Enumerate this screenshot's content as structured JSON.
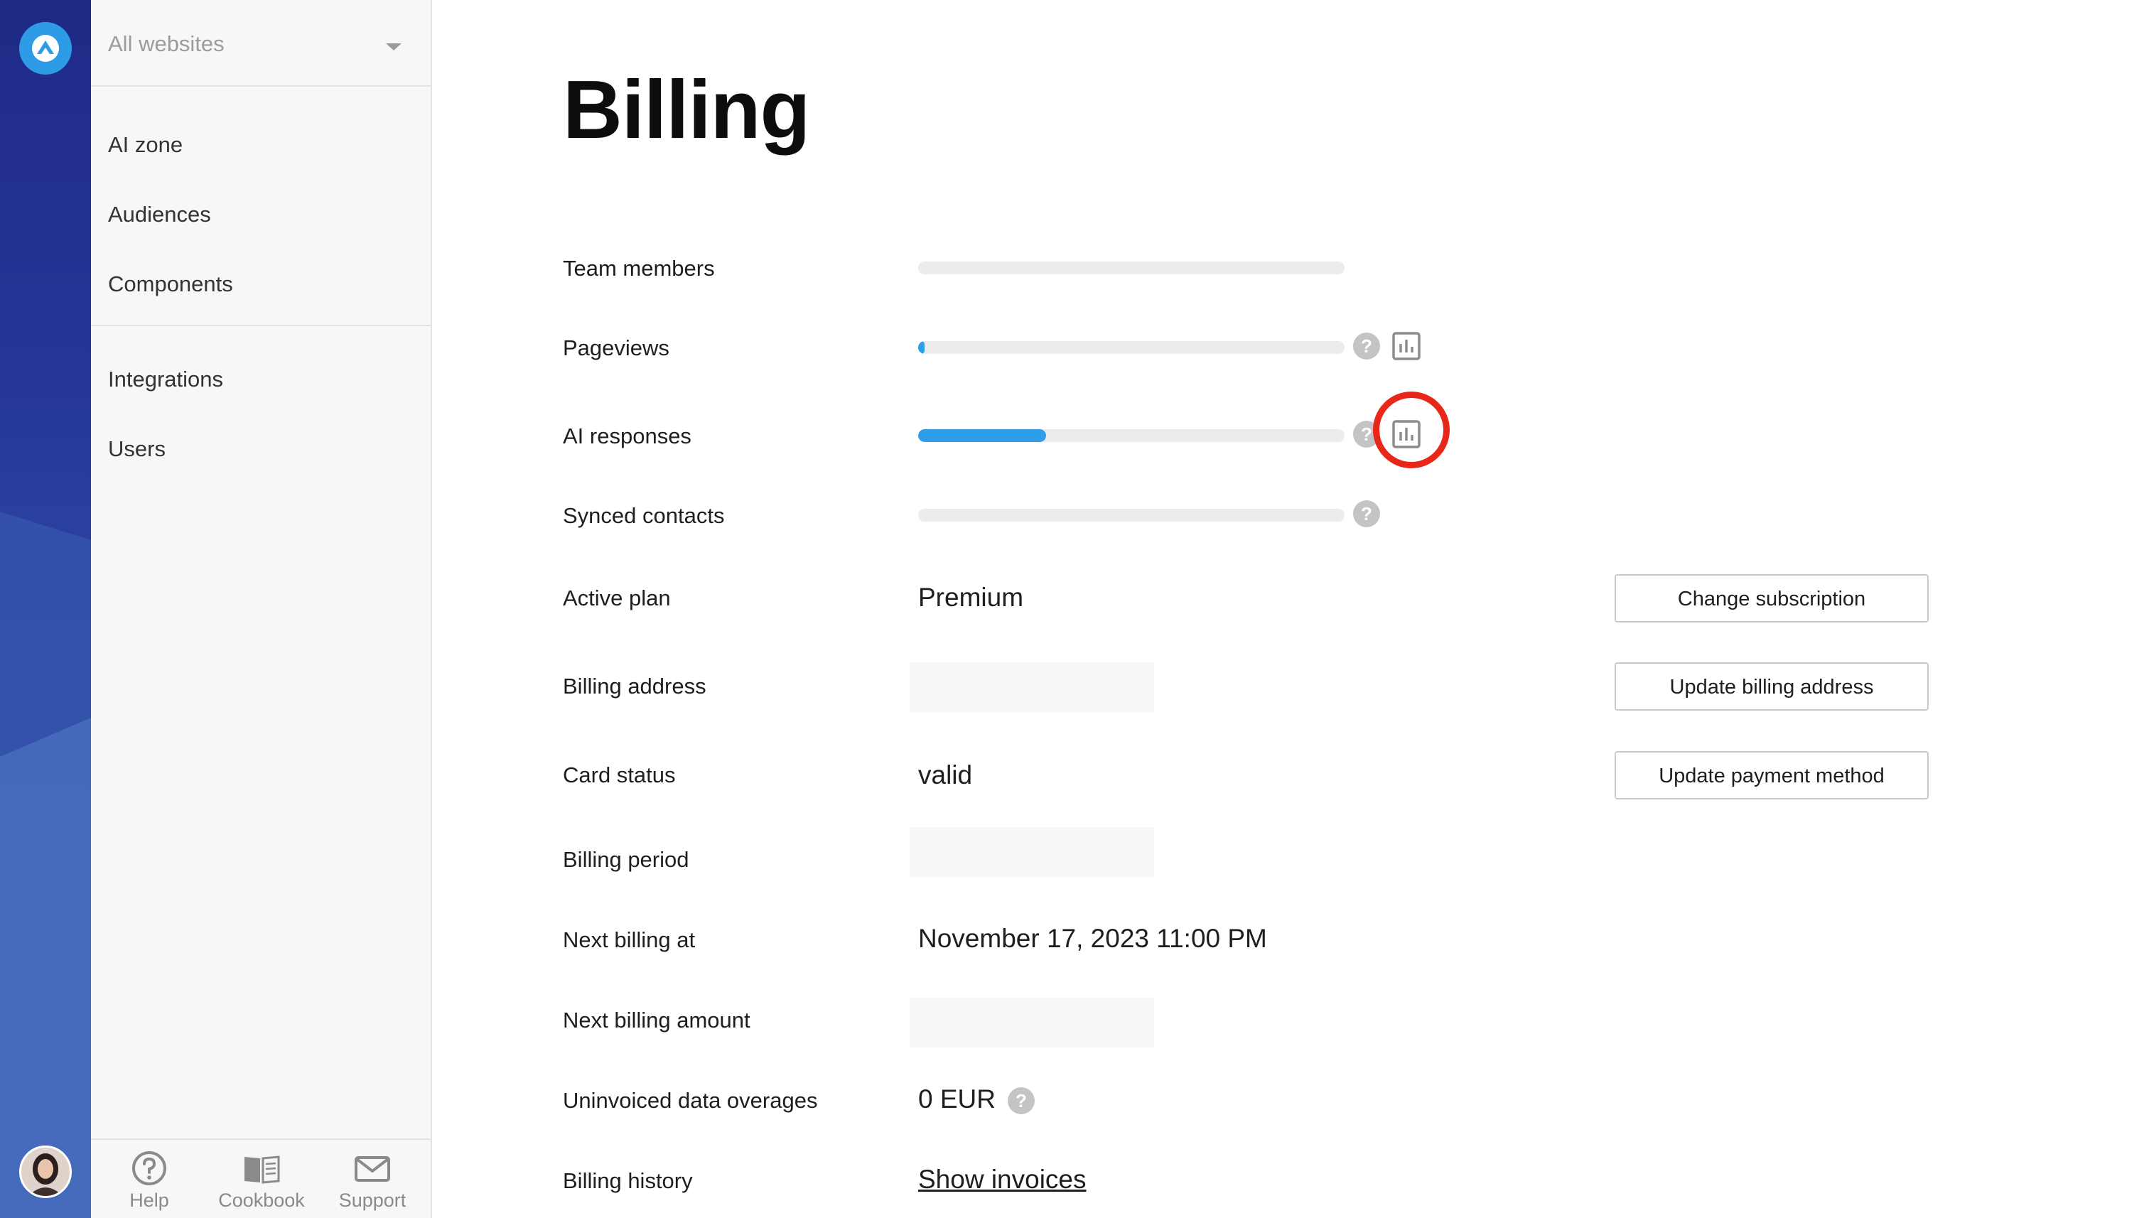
{
  "app": {
    "logo": "brand-logo-icon",
    "accent_color": "#2f9ee8",
    "highlight_color": "#e8261a"
  },
  "sidebar": {
    "site_selector": {
      "value": "All websites"
    },
    "items": [
      {
        "label": "AI zone"
      },
      {
        "label": "Audiences"
      },
      {
        "label": "Components"
      },
      {
        "label": "Integrations"
      },
      {
        "label": "Users"
      }
    ],
    "bottom": [
      {
        "label": "Help",
        "icon": "help-circle-icon"
      },
      {
        "label": "Cookbook",
        "icon": "book-icon"
      },
      {
        "label": "Support",
        "icon": "mail-icon"
      }
    ]
  },
  "main": {
    "title": "Billing",
    "usage": [
      {
        "label": "Team members",
        "progress": 0.0
      },
      {
        "label": "Pageviews",
        "progress": 0.01
      },
      {
        "label": "AI responses",
        "progress": 0.3
      },
      {
        "label": "Synced contacts",
        "progress": 0.0
      }
    ],
    "active_plan": {
      "label": "Active plan",
      "value": "Premium",
      "button": "Change subscription"
    },
    "billing_address": {
      "label": "Billing address",
      "button": "Update billing address"
    },
    "card_status": {
      "label": "Card status",
      "value": "valid",
      "button": "Update payment method"
    },
    "billing_period": {
      "label": "Billing period"
    },
    "next_billing_at": {
      "label": "Next billing at",
      "value": "November 17, 2023 11:00 PM"
    },
    "next_billing_amount": {
      "label": "Next billing amount"
    },
    "uninvoiced_overages": {
      "label": "Uninvoiced data overages",
      "value": "0 EUR"
    },
    "billing_history": {
      "label": "Billing history",
      "link": "Show invoices"
    }
  }
}
